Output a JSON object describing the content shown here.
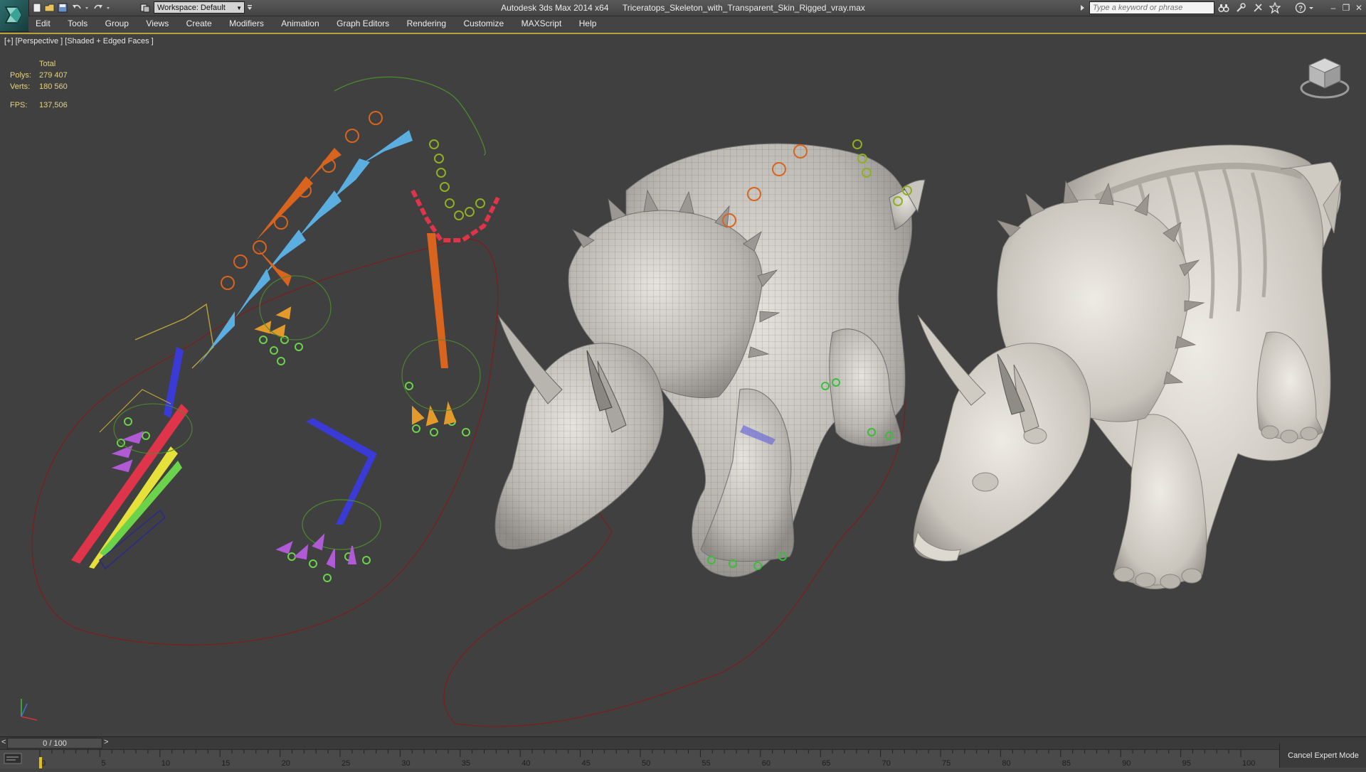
{
  "titlebar": {
    "app_name": "Autodesk 3ds Max  2014 x64",
    "file_name": "Triceratops_Skeleton_with_Transparent_Skin_Rigged_vray.max",
    "workspace": "Workspace: Default",
    "search_placeholder": "Type a keyword or phrase"
  },
  "menu": {
    "items": [
      {
        "label": "Edit"
      },
      {
        "label": "Tools"
      },
      {
        "label": "Group"
      },
      {
        "label": "Views"
      },
      {
        "label": "Create"
      },
      {
        "label": "Modifiers"
      },
      {
        "label": "Animation"
      },
      {
        "label": "Graph Editors"
      },
      {
        "label": "Rendering"
      },
      {
        "label": "Customize"
      },
      {
        "label": "MAXScript"
      },
      {
        "label": "Help"
      }
    ]
  },
  "viewport": {
    "label": "[+] [Perspective ] [Shaded + Edged Faces ]",
    "stats": {
      "header": "Total",
      "polys_label": "Polys:",
      "polys_value": "279 407",
      "verts_label": "Verts:",
      "verts_value": "180 560",
      "fps_label": "FPS:",
      "fps_value": "137,506"
    }
  },
  "timeline": {
    "slider_text": "0 / 100",
    "prev": "<",
    "next": ">",
    "ticks": [
      "0",
      "5",
      "10",
      "15",
      "20",
      "25",
      "30",
      "35",
      "40",
      "45",
      "50",
      "55",
      "60",
      "65",
      "70",
      "75",
      "80",
      "85",
      "90",
      "95",
      "100"
    ]
  },
  "status": {
    "cancel_expert_mode": "Cancel Expert Mode"
  },
  "colors": {
    "viewport_bg": "#404040",
    "active_border": "#b9a43a",
    "stats_text": "#e6d37a",
    "bone_blue": "#5aaee0",
    "bone_orange": "#d8641e",
    "bone_red": "#e0344a",
    "spline_red": "#7a1e1e"
  }
}
